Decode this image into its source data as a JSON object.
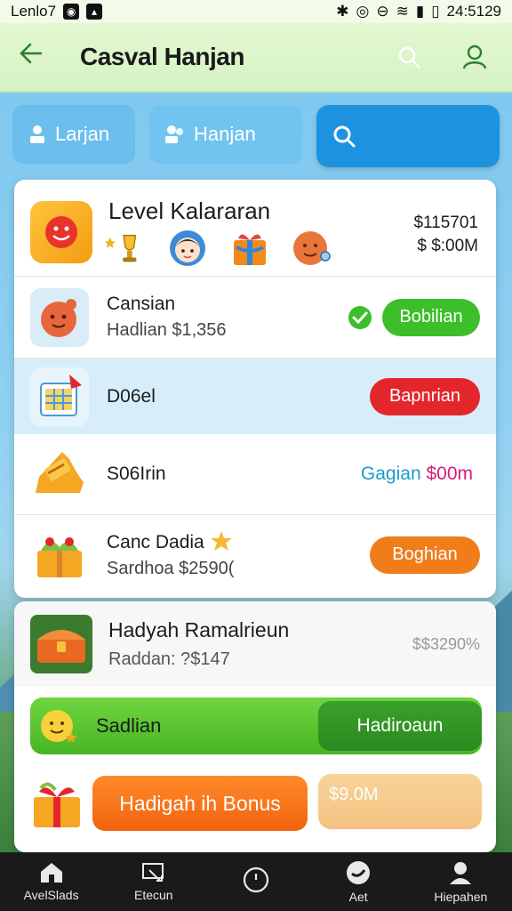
{
  "status": {
    "left_text": "Lenlo7",
    "time": "24:5129"
  },
  "appbar": {
    "title": "Casval Hanjan"
  },
  "tabs": [
    {
      "label": "Larjan"
    },
    {
      "label": "Hanjan"
    }
  ],
  "card1": {
    "title": "Level Kalararan",
    "price_line1": "$115701",
    "price_line2": "$ $:00M",
    "rows": [
      {
        "title": "Cansian",
        "subtitle": "Hadlian $1,356",
        "action": "Bobilian",
        "action_color": "#3cbf2a"
      },
      {
        "title": "D06el",
        "subtitle": "",
        "action": "Bapnrian",
        "action_color": "#e3262b"
      },
      {
        "title": "S06Irin",
        "subtitle": "",
        "value_left": "Gagian",
        "value_right": "$00m"
      },
      {
        "title": "Canc Dadia",
        "subtitle": "Sardhoa $2590(",
        "action": "Boghian",
        "action_color": "#f07d1c"
      }
    ]
  },
  "card2": {
    "reward_title": "Hadyah Ramalrieun",
    "reward_subtitle": "Raddan: ?$147",
    "reward_value": "$$3290%",
    "greenbar_label": "Sadlian",
    "greenbar_button": "Hadiroaun",
    "bonus_button": "Hadigah ih Bonus",
    "bonus_value": "$9.0M"
  },
  "bottom_nav": [
    {
      "label": "AvelSlads",
      "icon": "home-icon"
    },
    {
      "label": "Etecun",
      "icon": "edit-icon"
    },
    {
      "label": "",
      "icon": "clock-icon"
    },
    {
      "label": "Aet",
      "icon": "chat-icon"
    },
    {
      "label": "Hiepahen",
      "icon": "profile-icon"
    }
  ],
  "colors": {
    "appbar_bg": "#d6f2c2",
    "search_blue": "#1d93e0",
    "green": "#49b524",
    "orange": "#f2630f",
    "red": "#e3262b"
  }
}
